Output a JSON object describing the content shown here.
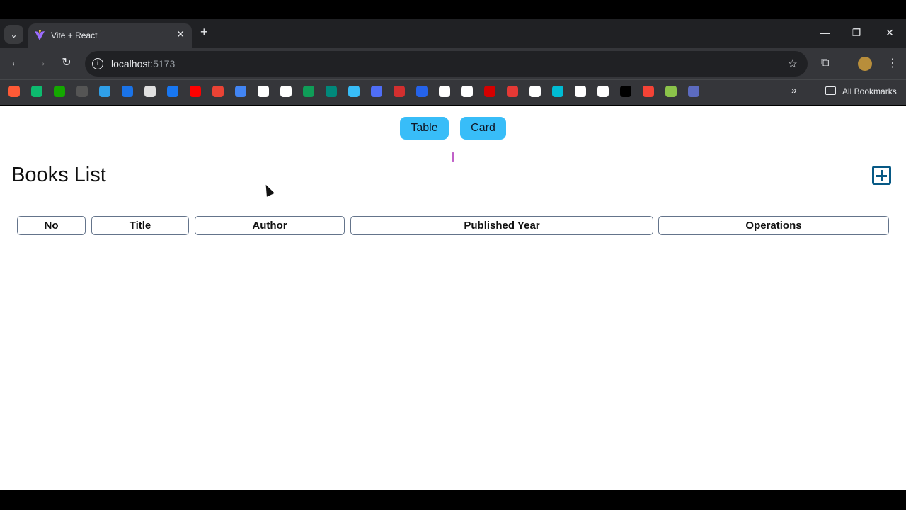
{
  "browser": {
    "tab_title": "Vite + React",
    "url_host": "localhost",
    "url_port": ":5173",
    "bookmarks_label": "All Bookmarks",
    "bookmark_colors": [
      "#ff5a36",
      "#0dbb6f",
      "#14a800",
      "#555",
      "#2f9fe8",
      "#1a73e8",
      "#e0e0e0",
      "#1877f2",
      "#ff0000",
      "#ea4335",
      "#4285f4",
      "#ffffff",
      "#ffffff",
      "#0f9d58",
      "#00897b",
      "#38bdf8",
      "#4f6ef7",
      "#d32f2f",
      "#2563eb",
      "#ffffff",
      "#ffffff",
      "#d50000",
      "#e53935",
      "#ffffff",
      "#00bcd4",
      "#ffffff",
      "#ffffff",
      "#000000",
      "#f44336",
      "#8bc34a",
      "#5c6bc0"
    ]
  },
  "page": {
    "toggle_table": "Table",
    "toggle_card": "Card",
    "title": "Books List",
    "headers": [
      "No",
      "Title",
      "Author",
      "Published Year",
      "Operations"
    ]
  }
}
